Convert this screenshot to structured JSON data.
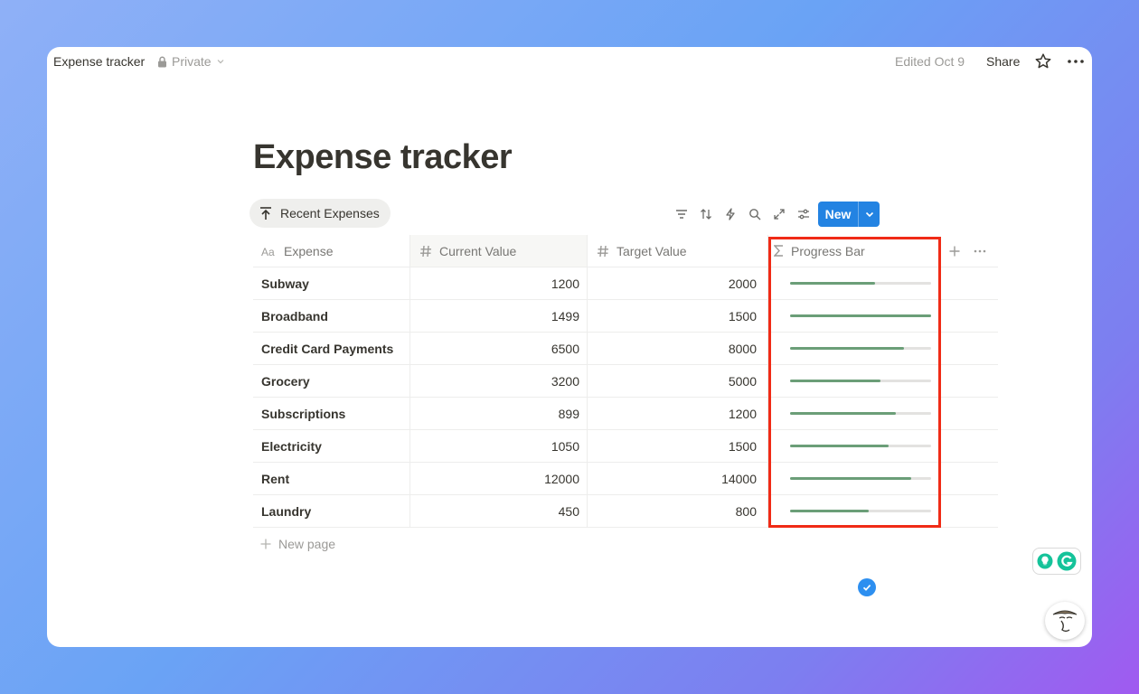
{
  "topbar": {
    "title": "Expense tracker",
    "privacy": "Private",
    "edited": "Edited Oct 9",
    "share": "Share"
  },
  "page": {
    "title": "Expense tracker",
    "view_tab": "Recent Expenses",
    "new_button": "New",
    "new_page": "New page"
  },
  "table": {
    "headers": {
      "expense": "Expense",
      "current": "Current Value",
      "target": "Target Value",
      "progress": "Progress Bar"
    },
    "rows": [
      {
        "expense": "Subway",
        "current": "1200",
        "target": "2000",
        "progress": 0.6
      },
      {
        "expense": "Broadband",
        "current": "1499",
        "target": "1500",
        "progress": 1.0
      },
      {
        "expense": "Credit Card Payments",
        "current": "6500",
        "target": "8000",
        "progress": 0.81
      },
      {
        "expense": "Grocery",
        "current": "3200",
        "target": "5000",
        "progress": 0.64
      },
      {
        "expense": "Subscriptions",
        "current": "899",
        "target": "1200",
        "progress": 0.75
      },
      {
        "expense": "Electricity",
        "current": "1050",
        "target": "1500",
        "progress": 0.7
      },
      {
        "expense": "Rent",
        "current": "12000",
        "target": "14000",
        "progress": 0.86
      },
      {
        "expense": "Laundry",
        "current": "450",
        "target": "800",
        "progress": 0.56
      }
    ]
  },
  "colors": {
    "accent": "#2383e2",
    "progress": "#6b9e78",
    "highlight": "#f02b16"
  }
}
